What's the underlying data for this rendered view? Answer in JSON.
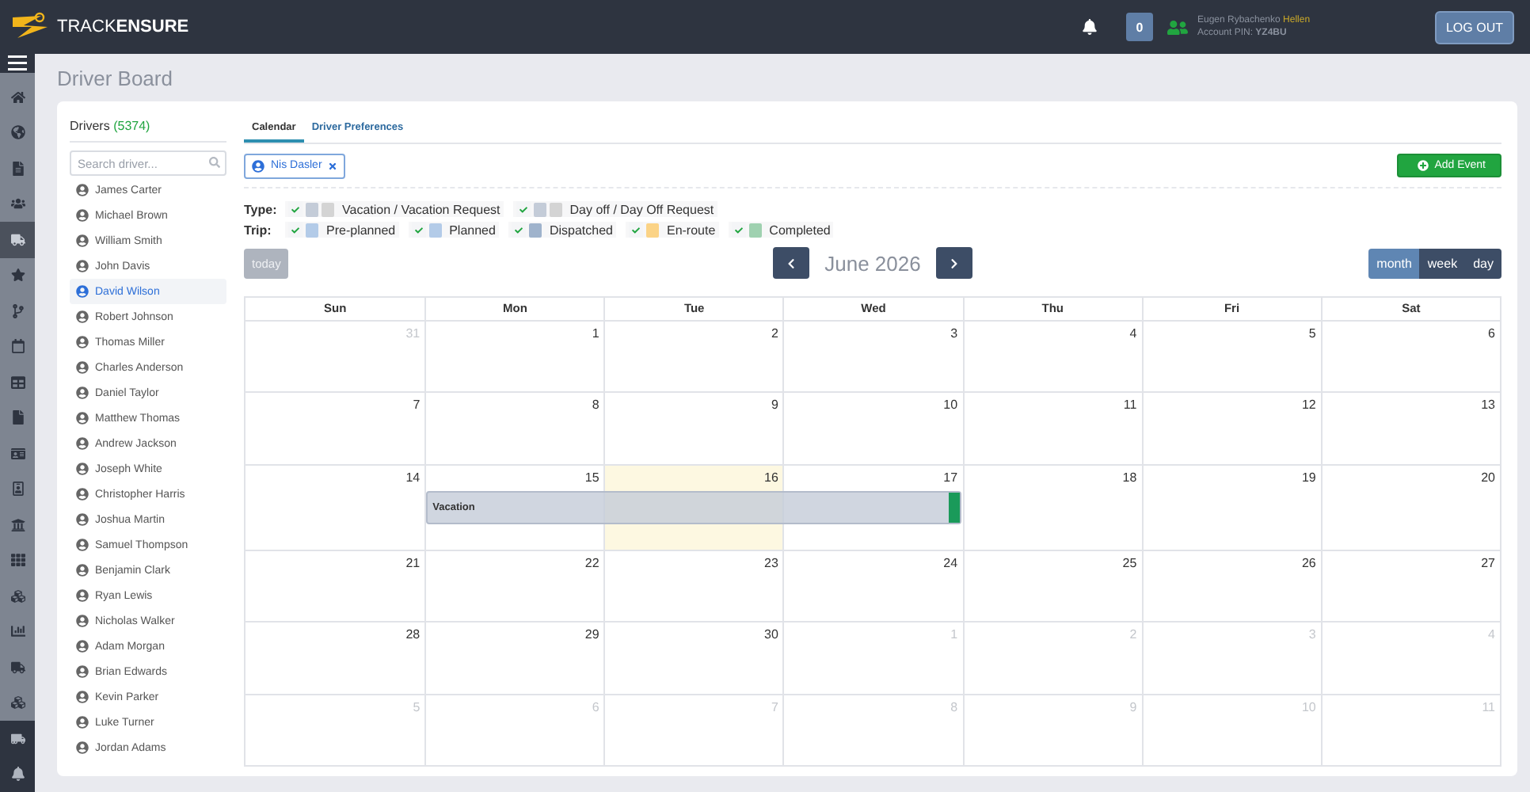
{
  "header": {
    "logo": {
      "light": "TRACK",
      "bold": "ENSURE"
    },
    "notifications": "0",
    "user": {
      "name": "Eugen Rybachenko",
      "role": "Hellen",
      "pin_label": "Account PIN:",
      "pin": "YZ4BU"
    },
    "logout": "LOG OUT"
  },
  "sidebar": {
    "items": [
      {
        "selected": false
      },
      {
        "selected": false
      },
      {
        "selected": false
      },
      {
        "selected": false
      },
      {
        "selected": true
      },
      {
        "selected": false
      },
      {
        "selected": false
      },
      {
        "selected": false
      },
      {
        "selected": false
      },
      {
        "selected": false
      },
      {
        "selected": false
      },
      {
        "selected": false
      },
      {
        "selected": false
      },
      {
        "selected": false
      },
      {
        "selected": false
      },
      {
        "selected": false
      },
      {
        "selected": false
      },
      {
        "selected": false
      }
    ]
  },
  "page_title": "Driver Board",
  "drivers": {
    "label": "Drivers",
    "count": "(5374)",
    "search": {
      "placeholder": "Search driver..."
    },
    "items": [
      {
        "name": "James Carter",
        "selected": false
      },
      {
        "name": "Michael Brown",
        "selected": false
      },
      {
        "name": "William Smith",
        "selected": false
      },
      {
        "name": "John Davis",
        "selected": false
      },
      {
        "name": "David Wilson",
        "selected": true
      },
      {
        "name": "Robert Johnson",
        "selected": false
      },
      {
        "name": "Thomas Miller",
        "selected": false
      },
      {
        "name": "Charles Anderson",
        "selected": false
      },
      {
        "name": "Daniel Taylor",
        "selected": false
      },
      {
        "name": "Matthew Thomas",
        "selected": false
      },
      {
        "name": "Andrew Jackson",
        "selected": false
      },
      {
        "name": "Joseph White",
        "selected": false
      },
      {
        "name": "Christopher Harris",
        "selected": false
      },
      {
        "name": "Joshua Martin",
        "selected": false
      },
      {
        "name": "Samuel Thompson",
        "selected": false
      },
      {
        "name": "Benjamin Clark",
        "selected": false
      },
      {
        "name": "Ryan Lewis",
        "selected": false
      },
      {
        "name": "Nicholas Walker",
        "selected": false
      },
      {
        "name": "Adam Morgan",
        "selected": false
      },
      {
        "name": "Brian Edwards",
        "selected": false
      },
      {
        "name": "Kevin Parker",
        "selected": false
      },
      {
        "name": "Luke Turner",
        "selected": false
      },
      {
        "name": "Jordan Adams",
        "selected": false
      }
    ]
  },
  "tabs": [
    {
      "label": "Calendar",
      "selected": true
    },
    {
      "label": "Driver Preferences",
      "selected": false
    }
  ],
  "filter_chip": "Nis Dasler",
  "add_event": "Add Event",
  "legend": {
    "type_label": "Type:",
    "types": [
      {
        "label": "Vacation / Vacation Request",
        "checked": true
      },
      {
        "label": "Day off / Day Off Request",
        "checked": true
      }
    ],
    "trip_label": "Trip:",
    "trips": [
      {
        "label": "Pre-planned",
        "checked": true,
        "color": "#b3cbe8"
      },
      {
        "label": "Planned",
        "checked": true,
        "color": "#b3cbe8"
      },
      {
        "label": "Dispatched",
        "checked": true,
        "color": "#9fb3cc"
      },
      {
        "label": "En-route",
        "checked": true,
        "color": "#fbd386"
      },
      {
        "label": "Completed",
        "checked": true,
        "color": "#9fd1b0"
      }
    ]
  },
  "toolbar": {
    "today": "today",
    "title": "June 2026",
    "views": [
      {
        "label": "month",
        "selected": true
      },
      {
        "label": "week",
        "selected": false
      },
      {
        "label": "day",
        "selected": false
      }
    ]
  },
  "calendar": {
    "weekdays": [
      "Sun",
      "Mon",
      "Tue",
      "Wed",
      "Thu",
      "Fri",
      "Sat"
    ],
    "weeks": [
      {
        "days": [
          {
            "n": "31",
            "other": true
          },
          {
            "n": "1",
            "other": false
          },
          {
            "n": "2",
            "other": false
          },
          {
            "n": "3",
            "other": false
          },
          {
            "n": "4",
            "other": false
          },
          {
            "n": "5",
            "other": false
          },
          {
            "n": "6",
            "other": false
          }
        ]
      },
      {
        "days": [
          {
            "n": "7",
            "other": false
          },
          {
            "n": "8",
            "other": false
          },
          {
            "n": "9",
            "other": false
          },
          {
            "n": "10",
            "other": false
          },
          {
            "n": "11",
            "other": false
          },
          {
            "n": "12",
            "other": false
          },
          {
            "n": "13",
            "other": false
          }
        ]
      },
      {
        "days": [
          {
            "n": "14",
            "other": false
          },
          {
            "n": "15",
            "other": false,
            "event": true
          },
          {
            "n": "16",
            "other": false,
            "today": true,
            "event": true
          },
          {
            "n": "17",
            "other": false,
            "event": true
          },
          {
            "n": "18",
            "other": false
          },
          {
            "n": "19",
            "other": false
          },
          {
            "n": "20",
            "other": false
          }
        ],
        "event": {
          "title": "Vacation"
        }
      },
      {
        "days": [
          {
            "n": "21",
            "other": false
          },
          {
            "n": "22",
            "other": false
          },
          {
            "n": "23",
            "other": false
          },
          {
            "n": "24",
            "other": false
          },
          {
            "n": "25",
            "other": false
          },
          {
            "n": "26",
            "other": false
          },
          {
            "n": "27",
            "other": false
          }
        ]
      },
      {
        "days": [
          {
            "n": "28",
            "other": false
          },
          {
            "n": "29",
            "other": false
          },
          {
            "n": "30",
            "other": false
          },
          {
            "n": "1",
            "other": true
          },
          {
            "n": "2",
            "other": true
          },
          {
            "n": "3",
            "other": true
          },
          {
            "n": "4",
            "other": true
          }
        ]
      },
      {
        "days": [
          {
            "n": "5",
            "other": true
          },
          {
            "n": "6",
            "other": true
          },
          {
            "n": "7",
            "other": true
          },
          {
            "n": "8",
            "other": true
          },
          {
            "n": "9",
            "other": true
          },
          {
            "n": "10",
            "other": true
          },
          {
            "n": "11",
            "other": true
          }
        ]
      }
    ]
  }
}
